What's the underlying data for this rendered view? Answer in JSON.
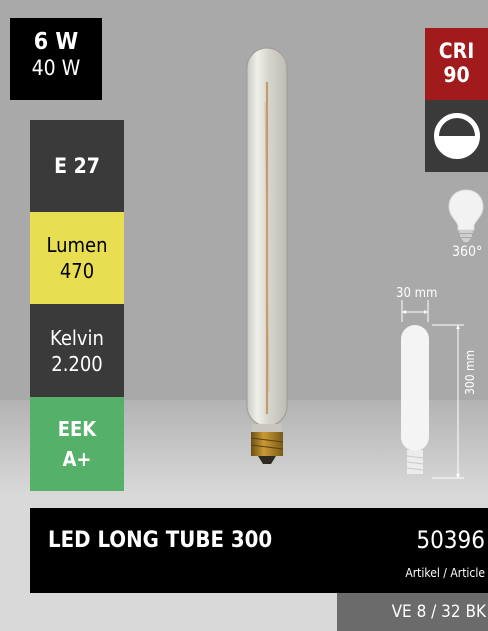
{
  "wattage": {
    "led": "6 W",
    "equivalent": "40 W"
  },
  "specs": {
    "socket": "E 27",
    "lumen_label": "Lumen",
    "lumen_value": "470",
    "kelvin_label": "Kelvin",
    "kelvin_value": "2.200",
    "eek_label": "EEK",
    "eek_value": "A+"
  },
  "badges": {
    "cri_label": "CRI",
    "cri_value": "90",
    "beam_angle": "360°"
  },
  "dimensions": {
    "width": "30 mm",
    "height": "300 mm"
  },
  "product": {
    "name": "LED LONG TUBE 300",
    "article_number": "50396",
    "article_label": "Artikel / Article",
    "packaging": "VE 8 / 32 BK"
  },
  "colors": {
    "photo_bg": "#a9a9a9",
    "black_panel": "#000000",
    "dark_panel": "#3a3a3a",
    "lumen_yellow": "#e7de52",
    "eek_green": "#55b06a",
    "cri_red": "#a11a1c",
    "packaging_gray": "#6b6b6b"
  },
  "icons": [
    "dimmable-icon",
    "omnidirectional-bulb-icon",
    "tube-dimension-diagram"
  ]
}
